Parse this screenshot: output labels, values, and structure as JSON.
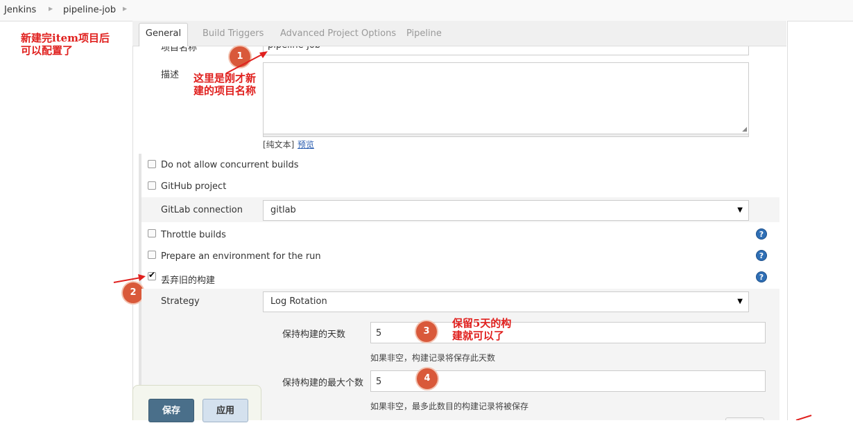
{
  "breadcrumb": {
    "root": "Jenkins",
    "job": "pipeline-job"
  },
  "annotations": {
    "top_left": [
      "新建完item项目后",
      "可以配置了"
    ],
    "name_note": [
      "这里是刚才新",
      "建的项目名称"
    ],
    "retention_note": [
      "保留5天的构",
      "建就可以了"
    ],
    "badges": [
      "1",
      "2",
      "3",
      "4"
    ]
  },
  "tabs": {
    "general": "General",
    "build_triggers": "Build Triggers",
    "advanced": "Advanced Project Options",
    "pipeline": "Pipeline"
  },
  "form": {
    "project_name_label": "项目名称",
    "project_name_value": "pipeline-job",
    "description_label": "描述",
    "plain_text": "[纯文本]",
    "preview": "预览",
    "concurrent": "Do not allow concurrent builds",
    "github": "GitHub project",
    "gitlab_label": "GitLab connection",
    "gitlab_value": "gitlab",
    "throttle": "Throttle builds",
    "prepare_env": "Prepare an environment for the run",
    "discard_old": "丢弃旧的构建",
    "strategy_label": "Strategy",
    "strategy_value": "Log Rotation",
    "days_label": "保持构建的天数",
    "days_value": "5",
    "days_help": "如果非空，构建记录将保存此天数",
    "max_label": "保持构建的最大个数",
    "max_value": "5",
    "max_help": "如果非空，最多此数目的构建记录将被保存",
    "help_glyph": "?",
    "caret_glyph": "▼"
  },
  "buttons": {
    "save": "保存",
    "apply": "应用"
  },
  "colors": {
    "accent_red": "#e0201e",
    "badge": "#d9593a",
    "save_button": "#4a6f8a",
    "help_icon": "#2f6fb5"
  }
}
